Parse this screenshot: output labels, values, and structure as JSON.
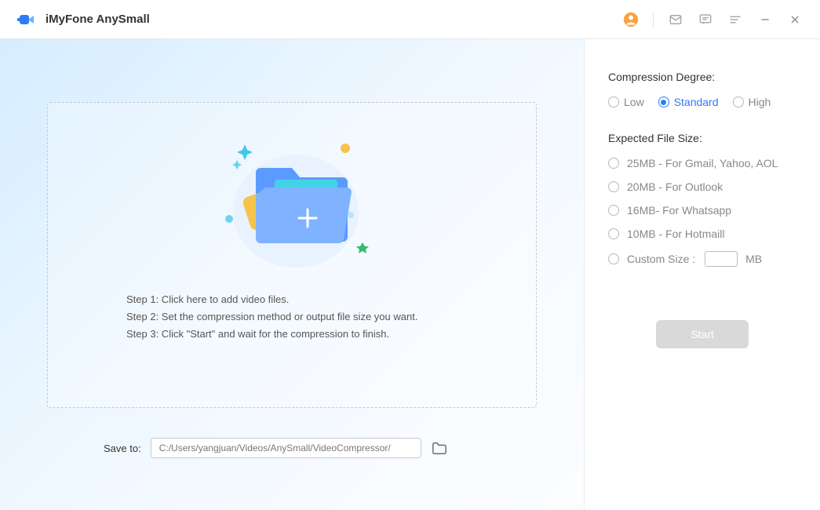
{
  "titlebar": {
    "app_name": "iMyFone AnySmall"
  },
  "dropzone": {
    "step1": "Step 1: Click here to add video files.",
    "step2": "Step 2: Set the compression method or output file size you want.",
    "step3": "Step 3: Click \"Start\" and wait for the compression to finish."
  },
  "save": {
    "label": "Save to:",
    "path": "C:/Users/yangjuan/Videos/AnySmall/VideoCompressor/"
  },
  "sidebar": {
    "compression_title": "Compression Degree:",
    "degrees": {
      "low": "Low",
      "standard": "Standard",
      "high": "High"
    },
    "expected_title": "Expected File Size:",
    "sizes": [
      "25MB - For Gmail, Yahoo, AOL",
      "20MB - For Outlook",
      "16MB- For Whatsapp",
      "10MB - For Hotmaill"
    ],
    "custom_label": "Custom Size :",
    "custom_unit": "MB",
    "start_label": "Start"
  },
  "colors": {
    "accent": "#2e7cf6",
    "profile": "#f9a43d"
  }
}
